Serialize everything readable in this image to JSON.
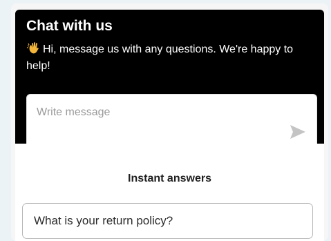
{
  "header": {
    "title": "Chat with us",
    "wave_icon": "waving-hand-icon",
    "subtitle": "Hi, message us with any questions. We're happy to help!"
  },
  "composer": {
    "placeholder": "Write message",
    "value": "",
    "send_icon": "send-arrow-icon"
  },
  "instant_answers": {
    "title": "Instant answers",
    "items": [
      {
        "label": "What is your return policy?"
      }
    ]
  },
  "colors": {
    "header_bg": "#000000",
    "header_text": "#ffffff",
    "send_icon": "#c4c4c4",
    "page_bg": "#ecf3f7"
  }
}
